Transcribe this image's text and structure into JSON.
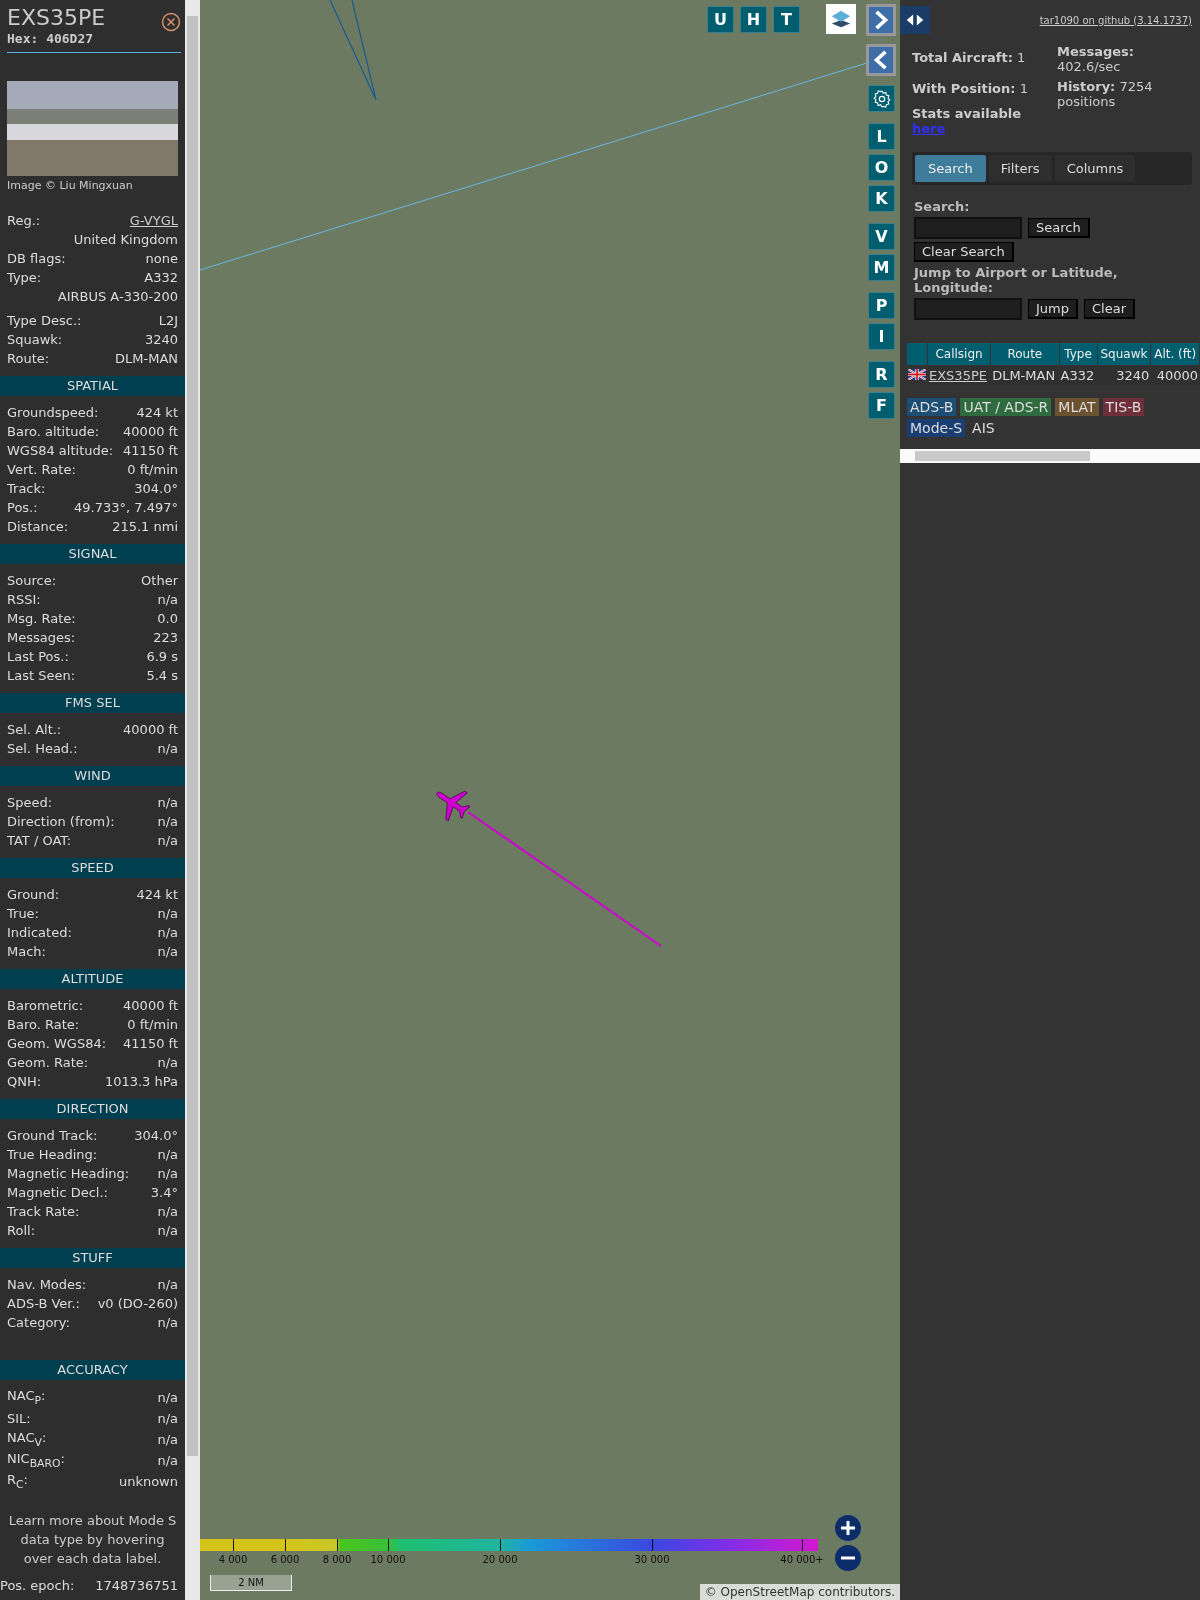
{
  "sidebar": {
    "callsign": "EXS35PE",
    "hex": "Hex: 406D27",
    "photo_credit": "Image © Liu Mingxuan",
    "registration": {
      "label": "Reg.:",
      "value": "G-VYGL"
    },
    "identity_rows": [
      {
        "label": "",
        "value": "United Kingdom"
      },
      {
        "label": "DB flags:",
        "value": "none"
      },
      {
        "label": "Type:",
        "value": "A332"
      },
      {
        "label": "",
        "value": "AIRBUS A-330-200"
      },
      {
        "label": "Type Desc.:",
        "value": "L2J"
      },
      {
        "label": "Squawk:",
        "value": "3240"
      },
      {
        "label": "Route:",
        "value": "DLM-MAN"
      }
    ],
    "sections": [
      {
        "title": "SPATIAL",
        "rows": [
          {
            "label": "Groundspeed:",
            "value": "424 kt"
          },
          {
            "label": "Baro. altitude:",
            "value": "40000 ft"
          },
          {
            "label": "WGS84 altitude:",
            "value": "41150 ft"
          },
          {
            "label": "Vert. Rate:",
            "value": "0 ft/min"
          },
          {
            "label": "Track:",
            "value": "304.0°"
          },
          {
            "label": "Pos.:",
            "value": "49.733°, 7.497°"
          },
          {
            "label": "Distance:",
            "value": "215.1 nmi"
          }
        ]
      },
      {
        "title": "SIGNAL",
        "rows": [
          {
            "label": "Source:",
            "value": "Other"
          },
          {
            "label": "RSSI:",
            "value": "n/a"
          },
          {
            "label": "Msg. Rate:",
            "value": "0.0"
          },
          {
            "label": "Messages:",
            "value": "223"
          },
          {
            "label": "Last Pos.:",
            "value": "6.9 s"
          },
          {
            "label": "Last Seen:",
            "value": "5.4 s"
          }
        ]
      },
      {
        "title": "FMS SEL",
        "rows": [
          {
            "label": "Sel. Alt.:",
            "value": "40000 ft"
          },
          {
            "label": "Sel. Head.:",
            "value": "n/a"
          }
        ]
      },
      {
        "title": "WIND",
        "rows": [
          {
            "label": "Speed:",
            "value": "n/a"
          },
          {
            "label": "Direction (from):",
            "value": "n/a"
          },
          {
            "label": "TAT / OAT:",
            "value": "n/a"
          }
        ]
      },
      {
        "title": "SPEED",
        "rows": [
          {
            "label": "Ground:",
            "value": "424 kt"
          },
          {
            "label": "True:",
            "value": "n/a"
          },
          {
            "label": "Indicated:",
            "value": "n/a"
          },
          {
            "label": "Mach:",
            "value": "n/a"
          }
        ]
      },
      {
        "title": "ALTITUDE",
        "rows": [
          {
            "label": "Barometric:",
            "value": "40000 ft"
          },
          {
            "label": "Baro. Rate:",
            "value": "0 ft/min"
          },
          {
            "label": "Geom. WGS84:",
            "value": "41150 ft"
          },
          {
            "label": "Geom. Rate:",
            "value": "n/a"
          },
          {
            "label": "QNH:",
            "value": "1013.3 hPa"
          }
        ]
      },
      {
        "title": "DIRECTION",
        "rows": [
          {
            "label": "Ground Track:",
            "value": "304.0°"
          },
          {
            "label": "True Heading:",
            "value": "n/a"
          },
          {
            "label": "Magnetic Heading:",
            "value": "n/a"
          },
          {
            "label": "Magnetic Decl.:",
            "value": "3.4°"
          },
          {
            "label": "Track Rate:",
            "value": "n/a"
          },
          {
            "label": "Roll:",
            "value": "n/a"
          }
        ]
      },
      {
        "title": "STUFF",
        "rows": [
          {
            "label": "Nav. Modes:",
            "value": "n/a"
          },
          {
            "label": "ADS-B Ver.:",
            "value": "v0 (DO-260)"
          },
          {
            "label": "Category:",
            "value": "n/a"
          }
        ]
      },
      {
        "title": "ACCURACY",
        "rows": [
          {
            "label": "NAC$_{P}$:",
            "value": "n/a"
          },
          {
            "label": "SIL:",
            "value": "n/a"
          },
          {
            "label": "NAC$_{V}$:",
            "value": "n/a"
          },
          {
            "label": "NIC$_{BARO}$:",
            "value": "n/a"
          },
          {
            "label": "R$_{C}$:",
            "value": "unknown"
          }
        ]
      }
    ],
    "note": "Learn more about Mode S data type by hovering over each data label.",
    "footer": {
      "label": "Pos. epoch:",
      "value": "1748736751"
    }
  },
  "map": {
    "top_buttons": [
      "U",
      "H",
      "T"
    ],
    "side_groups": [
      [
        "L",
        "O",
        "K"
      ],
      [
        "V",
        "M"
      ],
      [
        "P",
        "I"
      ],
      [
        "R",
        "F"
      ]
    ],
    "legend_ticks": [
      "4 000",
      "6 000",
      "8 000",
      "10 000",
      "20 000",
      "30 000",
      "40 000+"
    ],
    "scale": "2 NM",
    "attribution": "© OpenStreetMap contributors."
  },
  "panel": {
    "github_link": "tar1090 on github (3.14.1737)",
    "stats_left": [
      "**Total Aircraft:** 1",
      "**With Position:** 1"
    ],
    "stats_right": [
      "**Messages:** 402.6/sec",
      "**History:** 7254 positions"
    ],
    "stats_note": "Stats available",
    "stats_link": "here",
    "tabs": [
      {
        "label": "Search",
        "selected": true
      },
      {
        "label": "Filters",
        "selected": false
      },
      {
        "label": "Columns",
        "selected": false
      }
    ],
    "search_label": "Search:",
    "search_button": "Search",
    "clear_search_button": "Clear Search",
    "jump_label": "Jump to Airport or Latitude, Longitude:",
    "jump_button": "Jump",
    "clear_button": "Clear",
    "table": {
      "columns": [
        "Callsign",
        "Route",
        "Type",
        "Squawk",
        "Alt. (ft)"
      ],
      "rows": [
        {
          "callsign": "EXS35PE",
          "route": "DLM-MAN",
          "type": "A332",
          "squawk": "3240",
          "altitude": "40000"
        }
      ]
    },
    "sources": [
      {
        "label": "ADS-B",
        "color": "#1d4e73"
      },
      {
        "label": "UAT / ADS-R",
        "color": "#2f6b3e"
      },
      {
        "label": "MLAT",
        "color": "#6b5230"
      },
      {
        "label": "TIS-B",
        "color": "#6e2f38"
      },
      {
        "label": "Mode-S",
        "color": "#1b3e72"
      },
      {
        "label": "AIS",
        "color": "#333333"
      }
    ]
  }
}
